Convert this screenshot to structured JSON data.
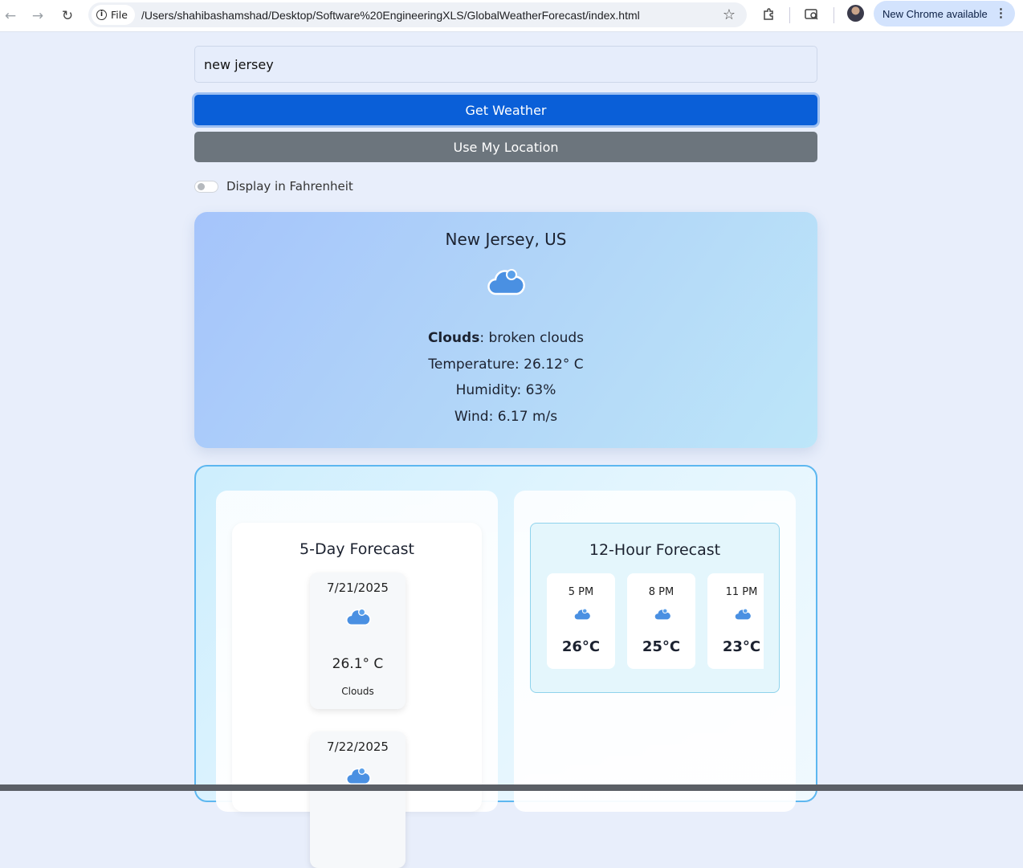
{
  "browser": {
    "file_label": "File",
    "url": "/Users/shahibashamshad/Desktop/Software%20EngineeringXLS/GlobalWeatherForecast/index.html",
    "update_label": "New Chrome available"
  },
  "search": {
    "value": "new jersey",
    "get_weather_label": "Get Weather",
    "location_label": "Use My Location",
    "toggle_label": "Display in Fahrenheit",
    "fahrenheit_on": false
  },
  "current": {
    "location": "New Jersey, US",
    "icon": "cloud-icon",
    "condition": "Clouds",
    "description": ": broken clouds",
    "temperature": "Temperature: 26.12° C",
    "humidity": "Humidity: 63%",
    "wind": "Wind: 6.17 m/s"
  },
  "daily": {
    "title": "5-Day Forecast",
    "items": [
      {
        "date": "7/21/2025",
        "icon": "cloud-icon",
        "temp": "26.1° C",
        "desc": "Clouds"
      },
      {
        "date": "7/22/2025",
        "icon": "cloud-icon",
        "temp": "",
        "desc": ""
      }
    ]
  },
  "hourly": {
    "title": "12-Hour Forecast",
    "items": [
      {
        "time": "5 PM",
        "icon": "cloud-icon",
        "temp": "26°C"
      },
      {
        "time": "8 PM",
        "icon": "cloud-icon",
        "temp": "25°C"
      },
      {
        "time": "11 PM",
        "icon": "cloud-icon",
        "temp": "23°C"
      }
    ]
  },
  "colors": {
    "primary_button": "#0a5fd8",
    "secondary_button": "#6c757d",
    "forecast_border": "#5db7f0",
    "cloud": "#4a90e2"
  }
}
